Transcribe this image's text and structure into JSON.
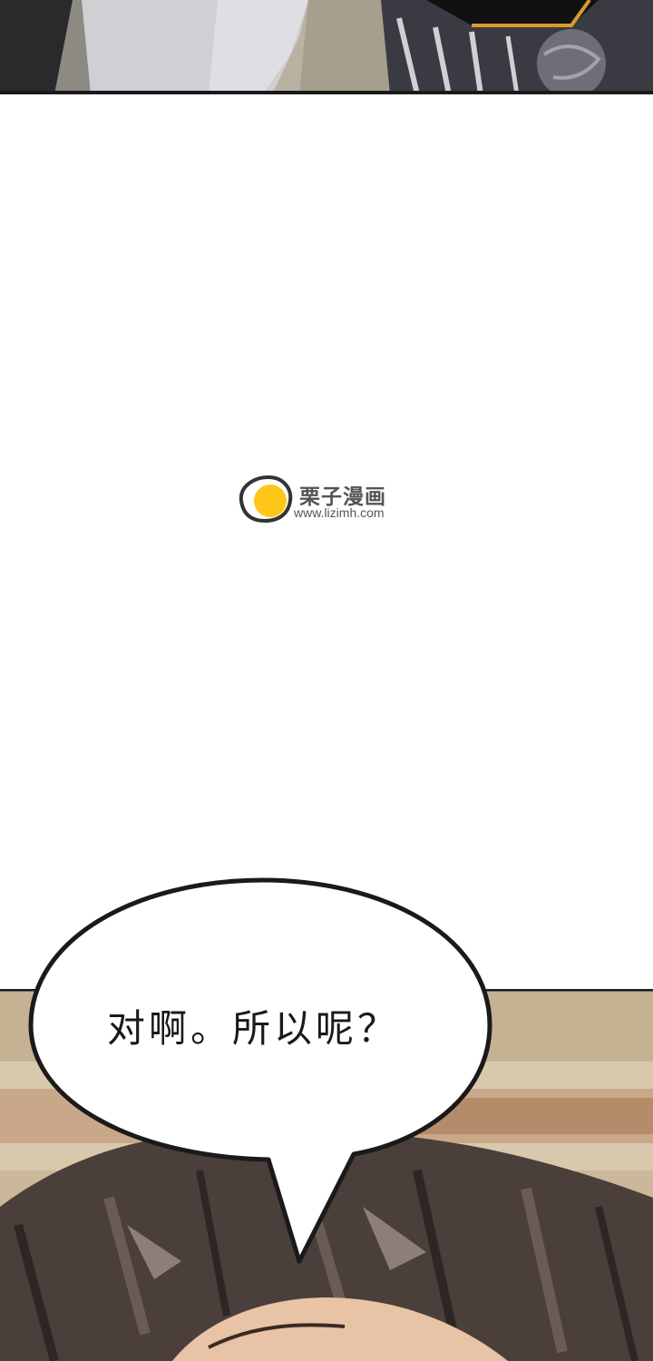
{
  "watermark": {
    "title": "栗子漫画",
    "url": "www.lizimh.com",
    "logo_icon": "chestnut-logo-icon",
    "logo_color": "#FFC619"
  },
  "speech_bubble": {
    "text": "对啊。所以呢？"
  },
  "colors": {
    "background": "#ffffff",
    "panel_border": "#1a1a1a",
    "hair": "#4a3f3a"
  }
}
